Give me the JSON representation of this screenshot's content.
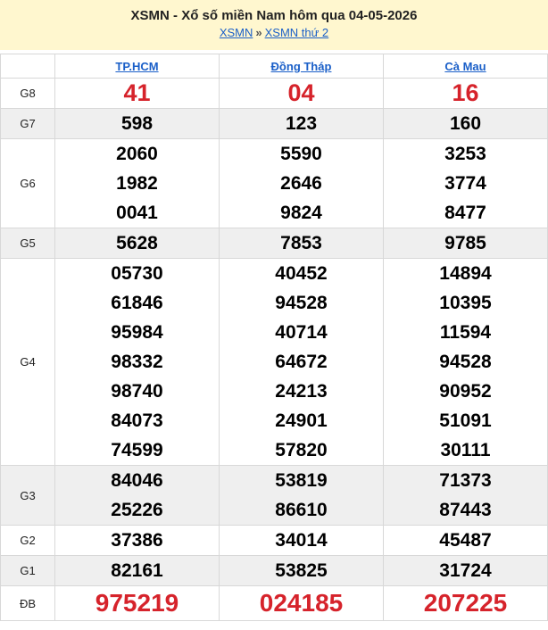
{
  "header": {
    "title": "XSMN - Xổ số miền Nam hôm qua 04-05-2026",
    "breadcrumb_1": "XSMN",
    "breadcrumb_sep": "»",
    "breadcrumb_2": "XSMN thứ 2"
  },
  "provinces": [
    "TP.HCM",
    "Đồng Tháp",
    "Cà Mau"
  ],
  "prizes": {
    "g8": {
      "label": "G8",
      "values": [
        [
          "41"
        ],
        [
          "04"
        ],
        [
          "16"
        ]
      ]
    },
    "g7": {
      "label": "G7",
      "values": [
        [
          "598"
        ],
        [
          "123"
        ],
        [
          "160"
        ]
      ]
    },
    "g6": {
      "label": "G6",
      "values": [
        [
          "2060",
          "1982",
          "0041"
        ],
        [
          "5590",
          "2646",
          "9824"
        ],
        [
          "3253",
          "3774",
          "8477"
        ]
      ]
    },
    "g5": {
      "label": "G5",
      "values": [
        [
          "5628"
        ],
        [
          "7853"
        ],
        [
          "9785"
        ]
      ]
    },
    "g4": {
      "label": "G4",
      "values": [
        [
          "05730",
          "61846",
          "95984",
          "98332",
          "98740",
          "84073",
          "74599"
        ],
        [
          "40452",
          "94528",
          "40714",
          "64672",
          "24213",
          "24901",
          "57820"
        ],
        [
          "14894",
          "10395",
          "11594",
          "94528",
          "90952",
          "51091",
          "30111"
        ]
      ]
    },
    "g3": {
      "label": "G3",
      "values": [
        [
          "84046",
          "25226"
        ],
        [
          "53819",
          "86610"
        ],
        [
          "71373",
          "87443"
        ]
      ]
    },
    "g2": {
      "label": "G2",
      "values": [
        [
          "37386"
        ],
        [
          "34014"
        ],
        [
          "45487"
        ]
      ]
    },
    "g1": {
      "label": "G1",
      "values": [
        [
          "82161"
        ],
        [
          "53825"
        ],
        [
          "31724"
        ]
      ]
    },
    "db": {
      "label": "ĐB",
      "values": [
        [
          "975219"
        ],
        [
          "024185"
        ],
        [
          "207225"
        ]
      ]
    }
  },
  "colors": {
    "header_bg": "#fff7cf",
    "link": "#1a5fc8",
    "highlight_red": "#d6232b",
    "shade_row": "#efefef",
    "border": "#d8d8d8"
  }
}
